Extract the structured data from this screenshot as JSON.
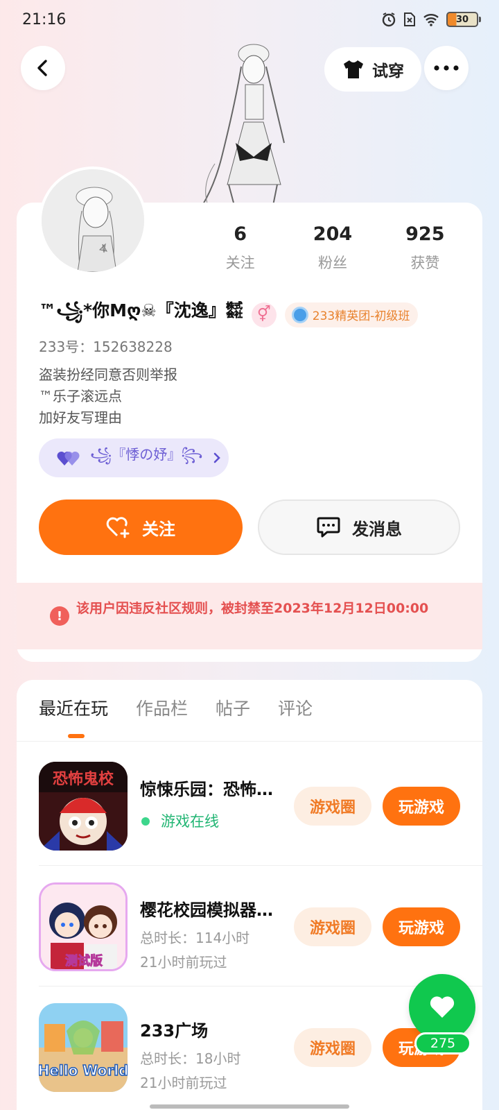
{
  "status_bar": {
    "time": "21:16",
    "battery": "30"
  },
  "header": {
    "tryon_label": "试穿"
  },
  "profile": {
    "nickname": "™꧁*你Mღ☠『沈逸』㍿",
    "gender_symbol": "⚥",
    "level_tag": "233精英团-初级班",
    "uid": "233号：152638228",
    "bio": [
      "盗装扮经同意否则举报",
      "™乐子滚远点",
      "加好友写理由"
    ],
    "cp_name": "꧁『悸の妤』꧂"
  },
  "stats": [
    {
      "num": "6",
      "label": "关注"
    },
    {
      "num": "204",
      "label": "粉丝"
    },
    {
      "num": "925",
      "label": "获赞"
    }
  ],
  "actions": {
    "follow": "关注",
    "message": "发消息"
  },
  "ban_notice": "该用户因违反社区规则，被封禁至2023年12月12日00:00",
  "tabs": [
    "最近在玩",
    "作品栏",
    "帖子",
    "评论"
  ],
  "games": [
    {
      "name": "惊悚乐园：恐怖鬼校",
      "line1": "游戏在线",
      "line2": "",
      "circle": "游戏圈",
      "play": "玩游戏"
    },
    {
      "name": "樱花校园模拟器测试版",
      "line1": "总时长：114小时",
      "line2": "21小时前玩过",
      "circle": "游戏圈",
      "play": "玩游戏"
    },
    {
      "name": "233广场",
      "line1": "总时长：18小时",
      "line2": "21小时前玩过",
      "circle": "游戏圈",
      "play": "玩游戏"
    }
  ],
  "game_icon_text": {
    "g1": "恐怖鬼校",
    "g2": "测试版",
    "g3": "Hello World"
  },
  "like_fab": {
    "count": "275"
  },
  "colors": {
    "accent": "#ff7210",
    "ban_text": "#e45050",
    "online": "#21b573",
    "like": "#10c84e"
  }
}
